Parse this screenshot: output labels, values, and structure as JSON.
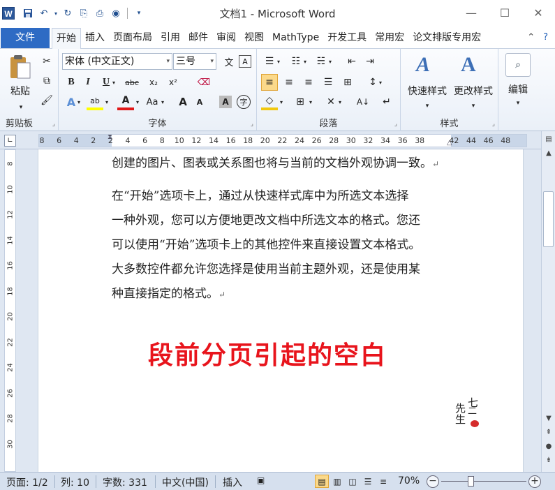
{
  "window": {
    "app_icon": "W",
    "title": "文档1 - Microsoft Word",
    "minimize_icon": "minimize-icon",
    "maximize_icon": "maximize-icon",
    "close_icon": "close-icon"
  },
  "tabs": {
    "file": "文件",
    "items": [
      "开始",
      "插入",
      "页面布局",
      "引用",
      "邮件",
      "审阅",
      "视图",
      "MathType",
      "开发工具",
      "常用宏",
      "论文排版专用宏"
    ],
    "active": "开始"
  },
  "ribbon": {
    "clipboard": {
      "paste_label": "粘贴",
      "group_label": "剪贴板"
    },
    "font": {
      "font_name": "宋体 (中文正文)",
      "font_size": "三号",
      "group_label": "字体",
      "bold": "B",
      "italic": "I",
      "underline": "U",
      "strike": "abc",
      "subscript": "x₂",
      "superscript": "x²",
      "change_case": "Aa",
      "grow": "A",
      "shrink": "A",
      "wen": "文",
      "a_box": "A",
      "char_shading": "A",
      "enclose": "字"
    },
    "paragraph": {
      "group_label": "段落"
    },
    "styles": {
      "quick_styles_label": "快速样式",
      "change_styles_label": "更改样式",
      "group_label": "样式"
    },
    "editing": {
      "label": "编辑"
    }
  },
  "ruler": {
    "numbers": [
      "8",
      "6",
      "4",
      "2",
      "2",
      "4",
      "6",
      "8",
      "10",
      "12",
      "14",
      "16",
      "18",
      "20",
      "22",
      "24",
      "26",
      "28",
      "30",
      "32",
      "34",
      "36",
      "38",
      "42",
      "44",
      "46",
      "48"
    ],
    "vertical_numbers": [
      "8",
      "10",
      "12",
      "14",
      "16",
      "18",
      "20",
      "22",
      "24",
      "26",
      "28",
      "30"
    ]
  },
  "document": {
    "line1": "创建的图片、图表或关系图也将与当前的文档外观协调一致。",
    "para2_lines": [
      "在“开始”选项卡上，通过从快速样式库中为所选文本选择",
      "一种外观，您可以方便地更改文档中所选文本的格式。您还",
      "可以使用“开始”选项卡上的其他控件来直接设置文本格式。",
      "大多数控件都允许您选择是使用当前主题外观，还是使用某",
      "种直接指定的格式。"
    ],
    "paragraph_mark": "↵",
    "annotation": "段前分页引起的空白",
    "seal_text": "七二先生"
  },
  "status": {
    "page": "页面: 1/2",
    "column": "列: 10",
    "word_count": "字数: 331",
    "language": "中文(中国)",
    "insert_mode": "插入",
    "zoom": "70%"
  },
  "colors": {
    "file_tab": "#2e6bc4",
    "annotation_red": "#e8141c",
    "highlight": "#fbd98a"
  }
}
